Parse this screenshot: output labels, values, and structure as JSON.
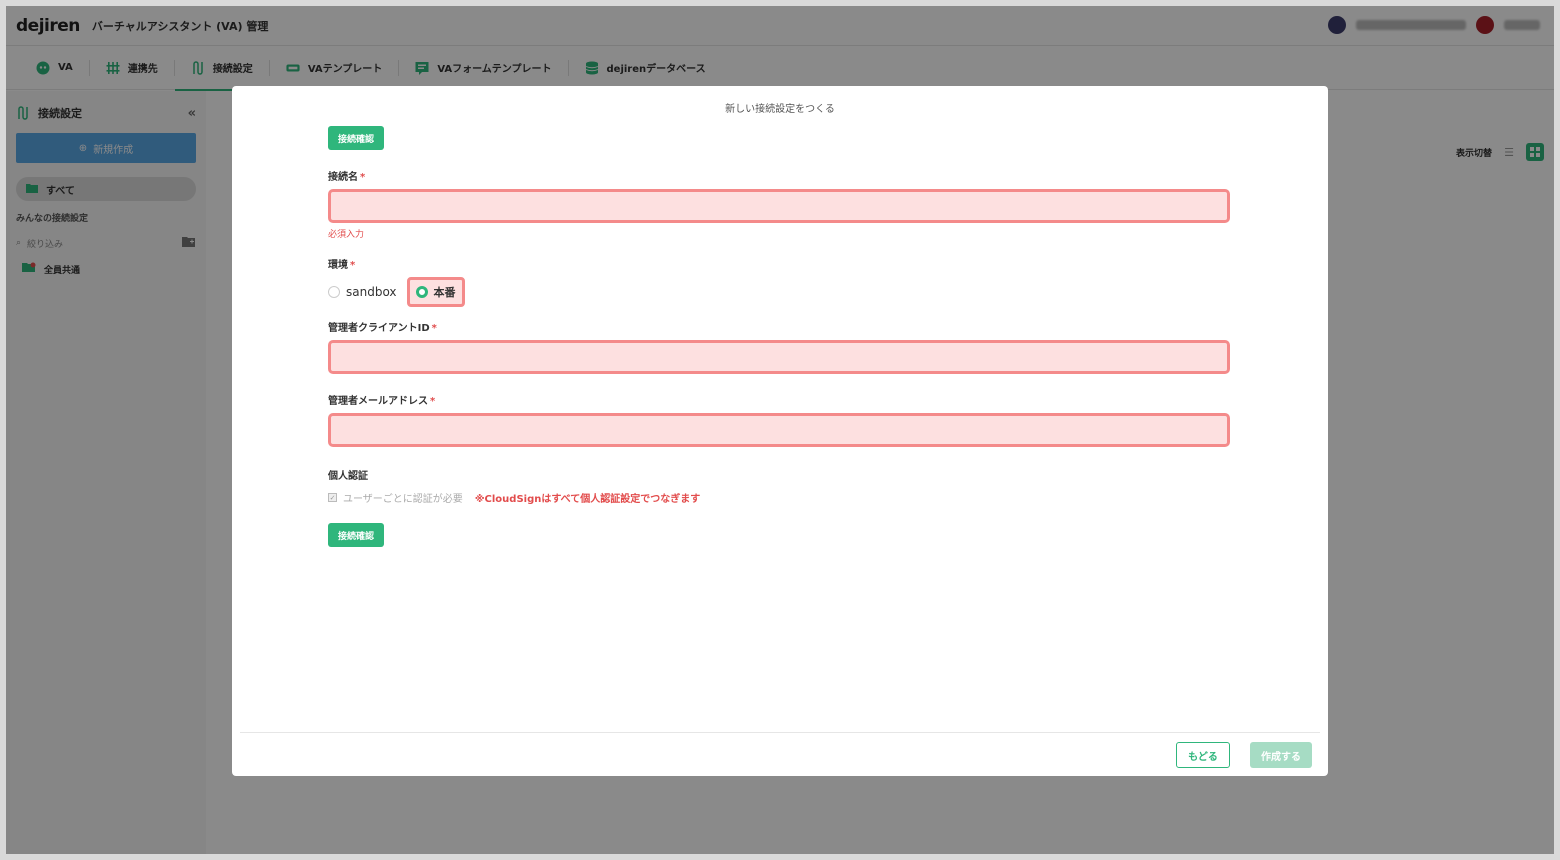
{
  "app": {
    "logo": "dejiren",
    "title": "バーチャルアシスタント (VA) 管理"
  },
  "nav": {
    "tabs": [
      {
        "label": "VA",
        "icon": "robot-icon"
      },
      {
        "label": "連携先",
        "icon": "sliders-icon"
      },
      {
        "label": "接続設定",
        "icon": "connection-icon"
      },
      {
        "label": "VAテンプレート",
        "icon": "template-icon"
      },
      {
        "label": "VAフォームテンプレート",
        "icon": "form-template-icon"
      },
      {
        "label": "dejirenデータベース",
        "icon": "database-icon"
      }
    ]
  },
  "sidebar": {
    "title": "接続設定",
    "new_button": "新規作成",
    "all_label": "すべて",
    "section_label": "みんなの接続設定",
    "filter_placeholder": "絞り込み",
    "shared_item": "全員共通"
  },
  "main": {
    "view_toggle_label": "表示切替"
  },
  "modal": {
    "title": "新しい接続設定をつくる",
    "check_button_top": "接続確認",
    "name_label": "接続名",
    "required_mark": "*",
    "required_error": "必須入力",
    "env_label": "環境",
    "env_options": [
      "sandbox",
      "本番"
    ],
    "env_selected": "本番",
    "client_id_label": "管理者クライアントID",
    "email_label": "管理者メールアドレス",
    "personal_auth_label": "個人認証",
    "personal_auth_checkbox": "ユーザーごとに認証が必要",
    "personal_auth_note": "※CloudSignはすべて個人認証設定でつなぎます",
    "check_button_bottom": "接続確認",
    "back_button": "もどる",
    "create_button": "作成する"
  },
  "colors": {
    "accent": "#2fb67c",
    "error": "#e24c4c",
    "error_field_bg": "#fde0e0",
    "error_field_border": "#f48a8a",
    "new_button": "#5aa8e6"
  }
}
